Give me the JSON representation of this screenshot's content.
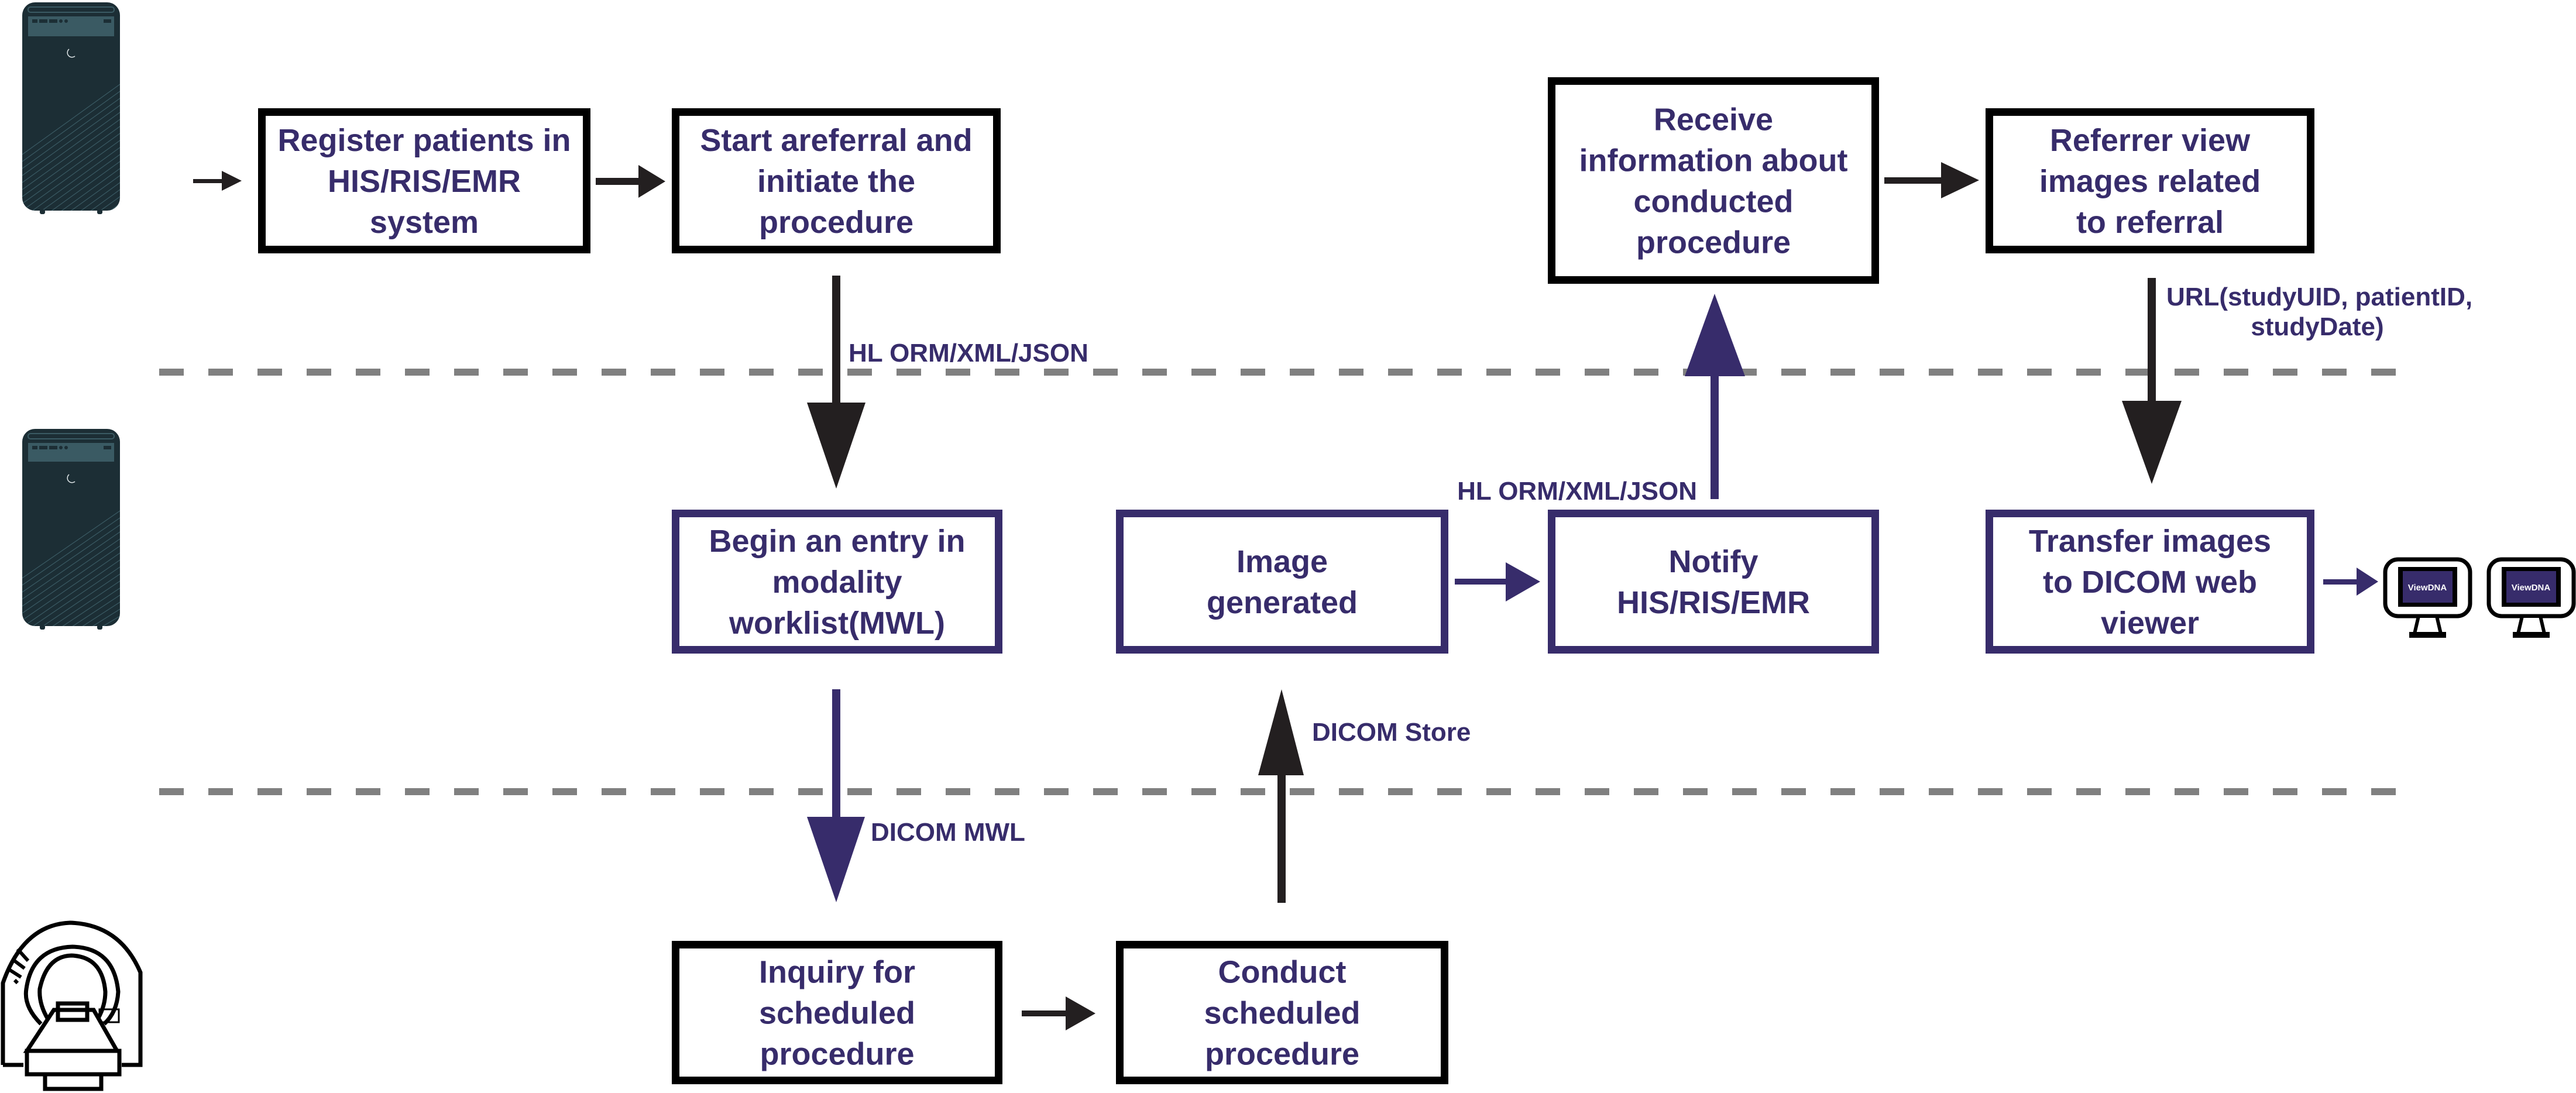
{
  "colors": {
    "text": "#372c6b",
    "purple": "#372c6b",
    "black": "#000000",
    "arrow_black": "#231f20",
    "divider": "#808080",
    "server_body": "#1c2e35",
    "server_panel": "#3a5a63",
    "monitor_screen": "#372c6b"
  },
  "lanes": [
    {
      "name": "his-ris-emr",
      "icon": "server-tower-icon"
    },
    {
      "name": "pacs",
      "icon": "server-tower-icon"
    },
    {
      "name": "modality",
      "icon": "ct-scanner-icon"
    }
  ],
  "boxes": {
    "register": {
      "lines": [
        "Register patients in",
        "HIS/RIS/EMR",
        "system"
      ],
      "border": "black"
    },
    "start": {
      "lines": [
        "Start areferral and",
        "initiate the",
        "procedure"
      ],
      "border": "black"
    },
    "receive": {
      "lines": [
        "Receive",
        "information about",
        "conducted",
        "procedure"
      ],
      "border": "black"
    },
    "referrer": {
      "lines": [
        "Referrer view",
        "images related",
        "to referral"
      ],
      "border": "black"
    },
    "begin": {
      "lines": [
        "Begin an entry in",
        "modality",
        "worklist(MWL)"
      ],
      "border": "purple"
    },
    "image": {
      "lines": [
        "Image",
        "generated"
      ],
      "border": "purple"
    },
    "notify": {
      "lines": [
        "Notify",
        "HIS/RIS/EMR"
      ],
      "border": "purple"
    },
    "transfer": {
      "lines": [
        "Transfer images",
        "to DICOM web",
        "viewer"
      ],
      "border": "purple"
    },
    "inquiry": {
      "lines": [
        "Inquiry for",
        "scheduled",
        "procedure"
      ],
      "border": "black"
    },
    "conduct": {
      "lines": [
        "Conduct",
        "scheduled",
        "procedure"
      ],
      "border": "black"
    }
  },
  "arrow_labels": {
    "start_to_begin": "HL ORM/XML/JSON",
    "notify_to_receive": "HL ORM/XML/JSON",
    "referrer_to_transfer_line1": "URL(studyUID, patientID,",
    "referrer_to_transfer_line2": "studyDate)",
    "image_store": "DICOM Store",
    "begin_to_inquiry": "DICOM MWL"
  },
  "viewers": [
    {
      "label": "ViewDNA"
    },
    {
      "label": "ViewDNA"
    }
  ]
}
